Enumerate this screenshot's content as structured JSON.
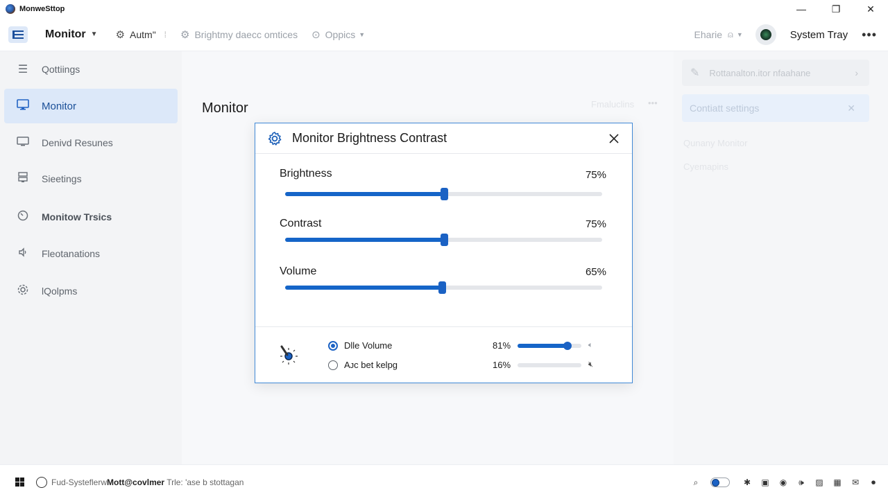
{
  "window": {
    "title": "MonweSttop",
    "minimize": "—",
    "maximize": "❐",
    "close": "✕"
  },
  "toolbar": {
    "title": "Monitor",
    "item_auto": "Autm\"",
    "item_brightness": "Brightmy daecc omtices",
    "item_options": "Oppics",
    "share": "Eharie",
    "system_tray": "System Tray",
    "more": "•••"
  },
  "sidebar": {
    "items": [
      {
        "label": "Qottiings",
        "icon": "menu-icon"
      },
      {
        "label": "Monitor",
        "icon": "monitor-icon"
      },
      {
        "label": "Denivd Resunes",
        "icon": "display-icon"
      },
      {
        "label": "Sieetings",
        "icon": "server-icon"
      },
      {
        "label": "Monitow Trsics",
        "icon": "clock-icon"
      },
      {
        "label": "Fleotanations",
        "icon": "speaker-icon"
      },
      {
        "label": "lQolpms",
        "icon": "gear-icon"
      }
    ]
  },
  "main": {
    "title": "Monitor",
    "ghost_label": "Fmaluclins",
    "ghost_more": "•••"
  },
  "right_panel": {
    "top_item": "Rottanalton.itor nfaahane",
    "settings_label": "Contiatt settings",
    "line1": "Qunany Monitor",
    "line2": "Cyemapins"
  },
  "dialog": {
    "title": "Monitor Brightness Contrast",
    "sliders": [
      {
        "label": "Brightness",
        "value_text": "75%",
        "value": 0.5
      },
      {
        "label": "Contrast",
        "value_text": "75%",
        "value": 0.5
      },
      {
        "label": "Volume",
        "value_text": "65%",
        "value": 0.495
      }
    ],
    "options": [
      {
        "label": "Dlle Volume",
        "selected": true,
        "value_text": "81%",
        "value": 0.78
      },
      {
        "label": "Aᴊc bet kelpg",
        "selected": false,
        "value_text": "16%",
        "value": 0.0
      }
    ]
  },
  "taskbar": {
    "search_text": "Fud-Systeflerw",
    "search_bold": "Mott@covlmer",
    "search_tail": "Trle:  'ase b stottagan"
  },
  "colors": {
    "accent": "#1565c8",
    "active_bg": "#dce8f9",
    "dialog_border": "#3f88d6"
  }
}
